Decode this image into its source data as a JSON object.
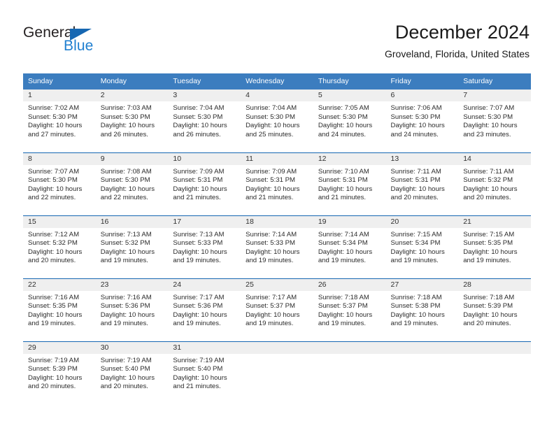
{
  "brand": {
    "name_top": "General",
    "name_bottom": "Blue",
    "triangle_color": "#1667b2",
    "top_color": "#231f20",
    "bottom_color": "#1f7fd0"
  },
  "header": {
    "title": "December 2024",
    "subtitle": "Groveland, Florida, United States"
  },
  "theme": {
    "header_bar": "#3c7dbf",
    "row_divider": "#1667b2",
    "daynum_band": "#efefef",
    "text": "#2b2b2b"
  },
  "weekdays": [
    "Sunday",
    "Monday",
    "Tuesday",
    "Wednesday",
    "Thursday",
    "Friday",
    "Saturday"
  ],
  "weeks": [
    [
      {
        "day": "1",
        "sunrise": "Sunrise: 7:02 AM",
        "sunset": "Sunset: 5:30 PM",
        "daylight": "Daylight: 10 hours and 27 minutes."
      },
      {
        "day": "2",
        "sunrise": "Sunrise: 7:03 AM",
        "sunset": "Sunset: 5:30 PM",
        "daylight": "Daylight: 10 hours and 26 minutes."
      },
      {
        "day": "3",
        "sunrise": "Sunrise: 7:04 AM",
        "sunset": "Sunset: 5:30 PM",
        "daylight": "Daylight: 10 hours and 26 minutes."
      },
      {
        "day": "4",
        "sunrise": "Sunrise: 7:04 AM",
        "sunset": "Sunset: 5:30 PM",
        "daylight": "Daylight: 10 hours and 25 minutes."
      },
      {
        "day": "5",
        "sunrise": "Sunrise: 7:05 AM",
        "sunset": "Sunset: 5:30 PM",
        "daylight": "Daylight: 10 hours and 24 minutes."
      },
      {
        "day": "6",
        "sunrise": "Sunrise: 7:06 AM",
        "sunset": "Sunset: 5:30 PM",
        "daylight": "Daylight: 10 hours and 24 minutes."
      },
      {
        "day": "7",
        "sunrise": "Sunrise: 7:07 AM",
        "sunset": "Sunset: 5:30 PM",
        "daylight": "Daylight: 10 hours and 23 minutes."
      }
    ],
    [
      {
        "day": "8",
        "sunrise": "Sunrise: 7:07 AM",
        "sunset": "Sunset: 5:30 PM",
        "daylight": "Daylight: 10 hours and 22 minutes."
      },
      {
        "day": "9",
        "sunrise": "Sunrise: 7:08 AM",
        "sunset": "Sunset: 5:30 PM",
        "daylight": "Daylight: 10 hours and 22 minutes."
      },
      {
        "day": "10",
        "sunrise": "Sunrise: 7:09 AM",
        "sunset": "Sunset: 5:31 PM",
        "daylight": "Daylight: 10 hours and 21 minutes."
      },
      {
        "day": "11",
        "sunrise": "Sunrise: 7:09 AM",
        "sunset": "Sunset: 5:31 PM",
        "daylight": "Daylight: 10 hours and 21 minutes."
      },
      {
        "day": "12",
        "sunrise": "Sunrise: 7:10 AM",
        "sunset": "Sunset: 5:31 PM",
        "daylight": "Daylight: 10 hours and 21 minutes."
      },
      {
        "day": "13",
        "sunrise": "Sunrise: 7:11 AM",
        "sunset": "Sunset: 5:31 PM",
        "daylight": "Daylight: 10 hours and 20 minutes."
      },
      {
        "day": "14",
        "sunrise": "Sunrise: 7:11 AM",
        "sunset": "Sunset: 5:32 PM",
        "daylight": "Daylight: 10 hours and 20 minutes."
      }
    ],
    [
      {
        "day": "15",
        "sunrise": "Sunrise: 7:12 AM",
        "sunset": "Sunset: 5:32 PM",
        "daylight": "Daylight: 10 hours and 20 minutes."
      },
      {
        "day": "16",
        "sunrise": "Sunrise: 7:13 AM",
        "sunset": "Sunset: 5:32 PM",
        "daylight": "Daylight: 10 hours and 19 minutes."
      },
      {
        "day": "17",
        "sunrise": "Sunrise: 7:13 AM",
        "sunset": "Sunset: 5:33 PM",
        "daylight": "Daylight: 10 hours and 19 minutes."
      },
      {
        "day": "18",
        "sunrise": "Sunrise: 7:14 AM",
        "sunset": "Sunset: 5:33 PM",
        "daylight": "Daylight: 10 hours and 19 minutes."
      },
      {
        "day": "19",
        "sunrise": "Sunrise: 7:14 AM",
        "sunset": "Sunset: 5:34 PM",
        "daylight": "Daylight: 10 hours and 19 minutes."
      },
      {
        "day": "20",
        "sunrise": "Sunrise: 7:15 AM",
        "sunset": "Sunset: 5:34 PM",
        "daylight": "Daylight: 10 hours and 19 minutes."
      },
      {
        "day": "21",
        "sunrise": "Sunrise: 7:15 AM",
        "sunset": "Sunset: 5:35 PM",
        "daylight": "Daylight: 10 hours and 19 minutes."
      }
    ],
    [
      {
        "day": "22",
        "sunrise": "Sunrise: 7:16 AM",
        "sunset": "Sunset: 5:35 PM",
        "daylight": "Daylight: 10 hours and 19 minutes."
      },
      {
        "day": "23",
        "sunrise": "Sunrise: 7:16 AM",
        "sunset": "Sunset: 5:36 PM",
        "daylight": "Daylight: 10 hours and 19 minutes."
      },
      {
        "day": "24",
        "sunrise": "Sunrise: 7:17 AM",
        "sunset": "Sunset: 5:36 PM",
        "daylight": "Daylight: 10 hours and 19 minutes."
      },
      {
        "day": "25",
        "sunrise": "Sunrise: 7:17 AM",
        "sunset": "Sunset: 5:37 PM",
        "daylight": "Daylight: 10 hours and 19 minutes."
      },
      {
        "day": "26",
        "sunrise": "Sunrise: 7:18 AM",
        "sunset": "Sunset: 5:37 PM",
        "daylight": "Daylight: 10 hours and 19 minutes."
      },
      {
        "day": "27",
        "sunrise": "Sunrise: 7:18 AM",
        "sunset": "Sunset: 5:38 PM",
        "daylight": "Daylight: 10 hours and 19 minutes."
      },
      {
        "day": "28",
        "sunrise": "Sunrise: 7:18 AM",
        "sunset": "Sunset: 5:39 PM",
        "daylight": "Daylight: 10 hours and 20 minutes."
      }
    ],
    [
      {
        "day": "29",
        "sunrise": "Sunrise: 7:19 AM",
        "sunset": "Sunset: 5:39 PM",
        "daylight": "Daylight: 10 hours and 20 minutes."
      },
      {
        "day": "30",
        "sunrise": "Sunrise: 7:19 AM",
        "sunset": "Sunset: 5:40 PM",
        "daylight": "Daylight: 10 hours and 20 minutes."
      },
      {
        "day": "31",
        "sunrise": "Sunrise: 7:19 AM",
        "sunset": "Sunset: 5:40 PM",
        "daylight": "Daylight: 10 hours and 21 minutes."
      },
      {
        "day": "",
        "sunrise": "",
        "sunset": "",
        "daylight": ""
      },
      {
        "day": "",
        "sunrise": "",
        "sunset": "",
        "daylight": ""
      },
      {
        "day": "",
        "sunrise": "",
        "sunset": "",
        "daylight": ""
      },
      {
        "day": "",
        "sunrise": "",
        "sunset": "",
        "daylight": ""
      }
    ]
  ]
}
